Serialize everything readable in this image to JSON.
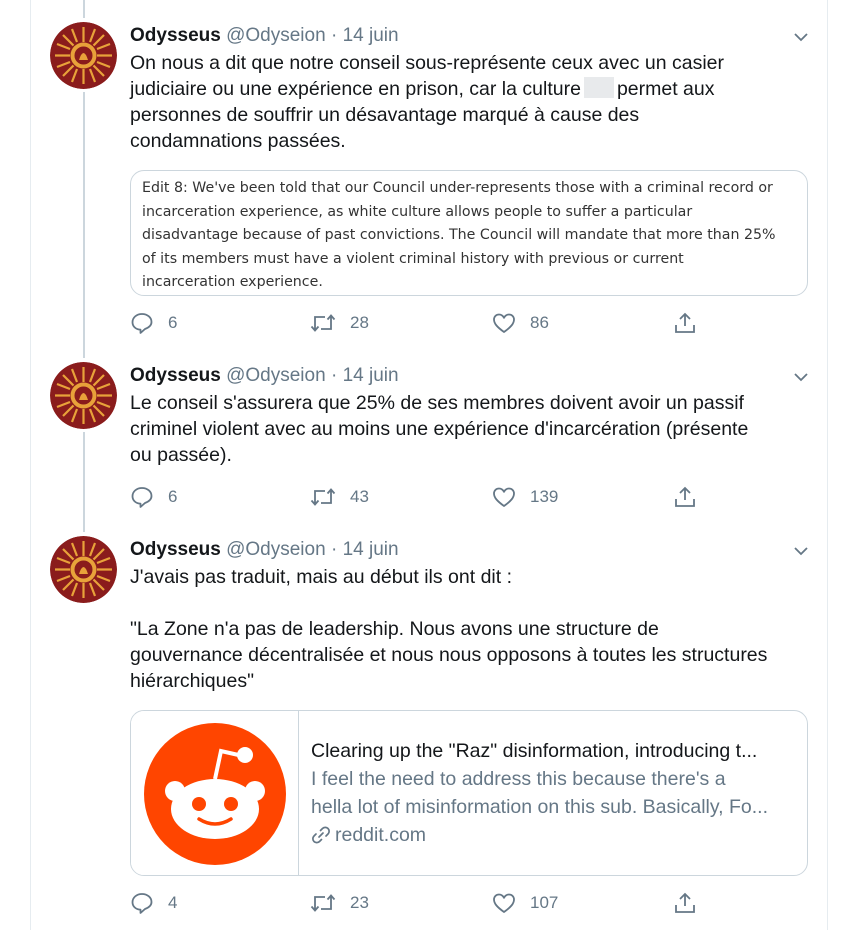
{
  "tweets": [
    {
      "name": "Odysseus",
      "handle": "@Odyseion",
      "separator": "·",
      "date": "14 juin",
      "text_before_redaction": "On nous a dit que notre conseil sous-représente ceux avec un casier\njudiciaire ou une expérience en prison, car la culture",
      "text_after_redaction": "permet aux\npersonnes de souffrir un désavantage marqué à cause des\ncondamnations passées.",
      "quoted_text": "Edit 8: We've been told that our Council under-represents those with a criminal record or\nincarceration experience, as white culture allows people to suffer a particular\ndisadvantage because of past convictions. The Council will mandate that more than 25%\nof its members must have a violent criminal history with previous or current\nincarceration experience.",
      "replies": "6",
      "retweets": "28",
      "likes": "86"
    },
    {
      "name": "Odysseus",
      "handle": "@Odyseion",
      "separator": "·",
      "date": "14 juin",
      "text": "Le conseil s'assurera que 25% de ses membres doivent avoir un passif\ncriminel violent avec au moins une expérience d'incarcération (présente\nou passée).",
      "replies": "6",
      "retweets": "43",
      "likes": "139"
    },
    {
      "name": "Odysseus",
      "handle": "@Odyseion",
      "separator": "·",
      "date": "14 juin",
      "text": "J'avais pas traduit, mais au début ils ont dit :\n\n\"La Zone n'a pas de leadership. Nous avons une structure de\ngouvernance décentralisée et nous nous opposons à toutes les structures\nhiérarchiques\"",
      "card": {
        "title": "Clearing up the \"Raz\" disinformation, introducing t...",
        "description_line1": "I feel the need to address this because there's a",
        "description_line2": "hella lot of misinformation on this sub. Basically, Fo...",
        "domain": "reddit.com"
      },
      "replies": "4",
      "retweets": "23",
      "likes": "107"
    }
  ],
  "icons": {
    "reply": "reply-icon",
    "retweet": "retweet-icon",
    "like": "heart-icon",
    "share": "share-icon",
    "caret": "chevron-down-icon",
    "link": "link-icon",
    "reddit": "reddit-logo"
  },
  "colors": {
    "text": "#14171a",
    "secondary": "#657786",
    "border": "#ccd6dd",
    "reddit": "#ff4500"
  }
}
